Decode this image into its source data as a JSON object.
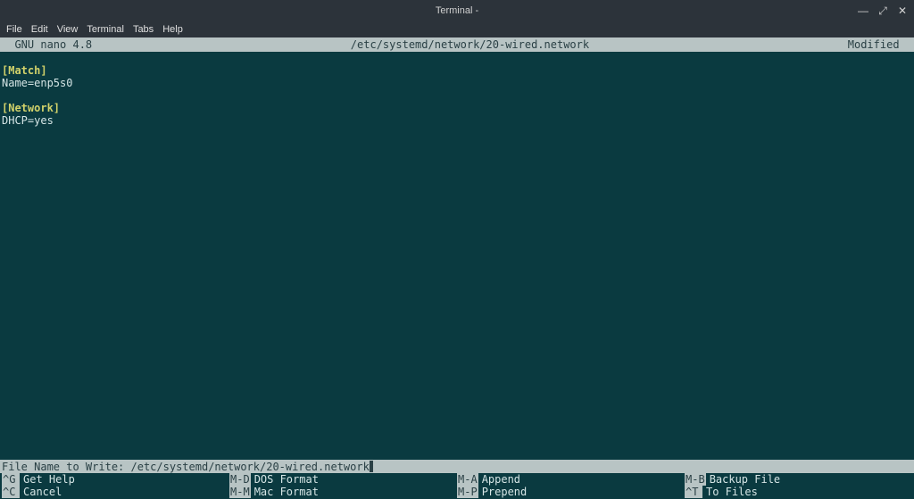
{
  "window": {
    "title": "Terminal -",
    "controls": {
      "min": "—",
      "max": "⤢",
      "close": "✕"
    }
  },
  "menubar": {
    "items": [
      "File",
      "Edit",
      "View",
      "Terminal",
      "Tabs",
      "Help"
    ]
  },
  "nano": {
    "header": {
      "left": "  GNU nano 4.8",
      "center": "/etc/systemd/network/20-wired.network",
      "right": "Modified  "
    },
    "content": {
      "section1": "[Match]",
      "line1": "Name=enp5s0",
      "blank": "",
      "section2": "[Network]",
      "line2": "DHCP=yes"
    },
    "prompt": {
      "label": "File Name to Write: ",
      "value": "/etc/systemd/network/20-wired.network"
    },
    "shortcuts": {
      "row1": [
        {
          "key": "^G",
          "label": "Get Help"
        },
        {
          "key": "M-D",
          "label": "DOS Format"
        },
        {
          "key": "M-A",
          "label": "Append"
        },
        {
          "key": "M-B",
          "label": "Backup File"
        }
      ],
      "row2": [
        {
          "key": "^C",
          "label": "Cancel"
        },
        {
          "key": "M-M",
          "label": "Mac Format"
        },
        {
          "key": "M-P",
          "label": "Prepend"
        },
        {
          "key": "^T",
          "label": "To Files"
        }
      ]
    }
  }
}
